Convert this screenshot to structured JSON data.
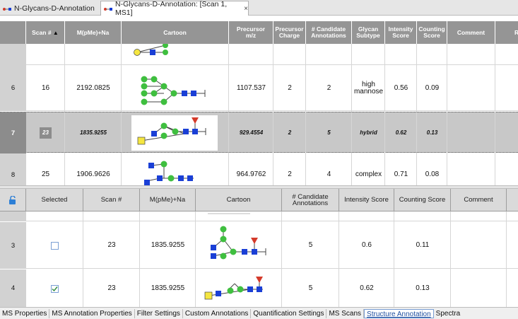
{
  "tabs": [
    {
      "label": "N-Glycans-D-Annotation"
    },
    {
      "label": "N-Glycans-D-Annotation: [Scan 1, MS1]",
      "close": "×"
    }
  ],
  "top_table": {
    "headers": [
      "Scan #",
      "M(pMe)+Na",
      "Cartoon",
      "Precursor m/z",
      "Precursor Charge",
      "# Candidate Annotations",
      "Glycan Subtype",
      "Intensity Score",
      "Counting Score",
      "Comment",
      "R"
    ],
    "sort_indicator": "▲",
    "rows": [
      {
        "row": "6",
        "scan": "16",
        "mass": "2192.0825",
        "mz": "1107.537",
        "charge": "2",
        "cand": "2",
        "subtype": "high mannose",
        "intensity": "0.56",
        "counting": "0.09"
      },
      {
        "row": "7",
        "scan": "23",
        "mass": "1835.9255",
        "mz": "929.4554",
        "charge": "2",
        "cand": "5",
        "subtype": "hybrid",
        "intensity": "0.62",
        "counting": "0.13"
      },
      {
        "row": "8",
        "scan": "25",
        "mass": "1906.9626",
        "mz": "964.9762",
        "charge": "2",
        "cand": "4",
        "subtype": "complex",
        "intensity": "0.71",
        "counting": "0.08"
      }
    ]
  },
  "bottom_table": {
    "headers": [
      "Selected",
      "Scan #",
      "M(pMe)+Na",
      "Cartoon",
      "# Candidate Annotations",
      "Intensity Score",
      "Counting Score",
      "Comment"
    ],
    "rows": [
      {
        "row": "3",
        "selected": false,
        "scan": "23",
        "mass": "1835.9255",
        "cand": "5",
        "intensity": "0.6",
        "counting": "0.11"
      },
      {
        "row": "4",
        "selected": true,
        "scan": "23",
        "mass": "1835.9255",
        "cand": "5",
        "intensity": "0.62",
        "counting": "0.13"
      }
    ]
  },
  "bottom_tabs": [
    "MS Properties",
    "MS Annotation Properties",
    "Filter Settings",
    "Custom Annotations",
    "Quantification Settings",
    "MS Scans",
    "Structure Annotation",
    "Spectra"
  ],
  "active_bottom_tab": "Structure Annotation",
  "colors": {
    "mannose": "#3fbf3f",
    "glcnac": "#1a3fd6",
    "galactose": "#f5e640",
    "fucose": "#d43a2a",
    "header_dark": "#959595",
    "selected_row": "#c8c8c8"
  }
}
